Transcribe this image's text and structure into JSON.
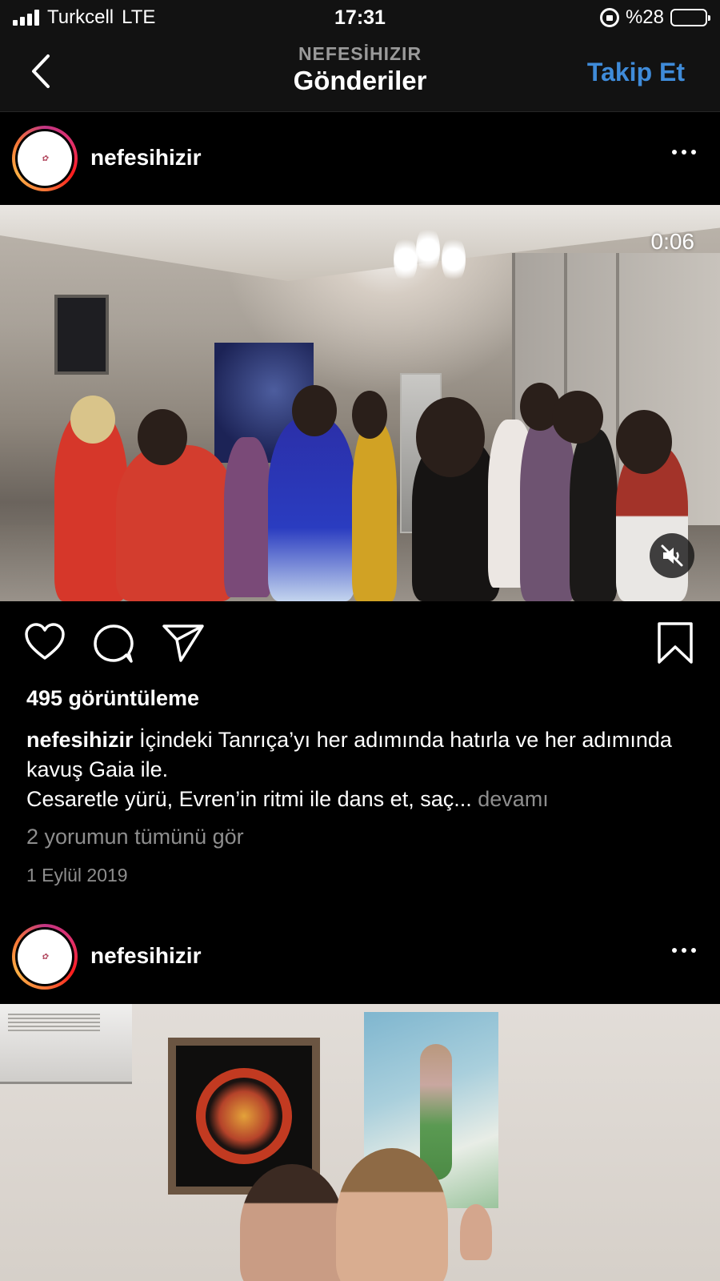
{
  "status_bar": {
    "carrier": "Turkcell",
    "network": "LTE",
    "time": "17:31",
    "battery": "%28",
    "battery_level": 0.28
  },
  "nav": {
    "subtitle": "NEFESİHIZIR",
    "title": "Gönderiler",
    "follow": "Takip Et"
  },
  "posts": [
    {
      "username": "nefesihizir",
      "media_type": "video",
      "video_time": "0:06",
      "views": "495 görüntüleme",
      "caption_user": "nefesihizir",
      "caption_text": "İçindeki Tanrıça’yı her adımında hatırla ve her adımında kavuş Gaia ile.",
      "caption_line2": "Cesaretle yürü, Evren’in ritmi ile dans et, saç...",
      "more": "devamı",
      "comments": "2 yorumun tümünü gör",
      "date": "1 Eylül 2019"
    },
    {
      "username": "nefesihizir",
      "media_type": "photo"
    }
  ],
  "icons": {
    "back": "chevron-left-icon",
    "more": "more-horizontal-icon",
    "like": "heart-icon",
    "comment": "comment-icon",
    "share": "send-icon",
    "save": "bookmark-icon",
    "mute": "speaker-muted-icon"
  },
  "colors": {
    "follow_blue": "#3f8bd9",
    "muted_text": "#8e8e8e",
    "header_bg": "#121212"
  }
}
